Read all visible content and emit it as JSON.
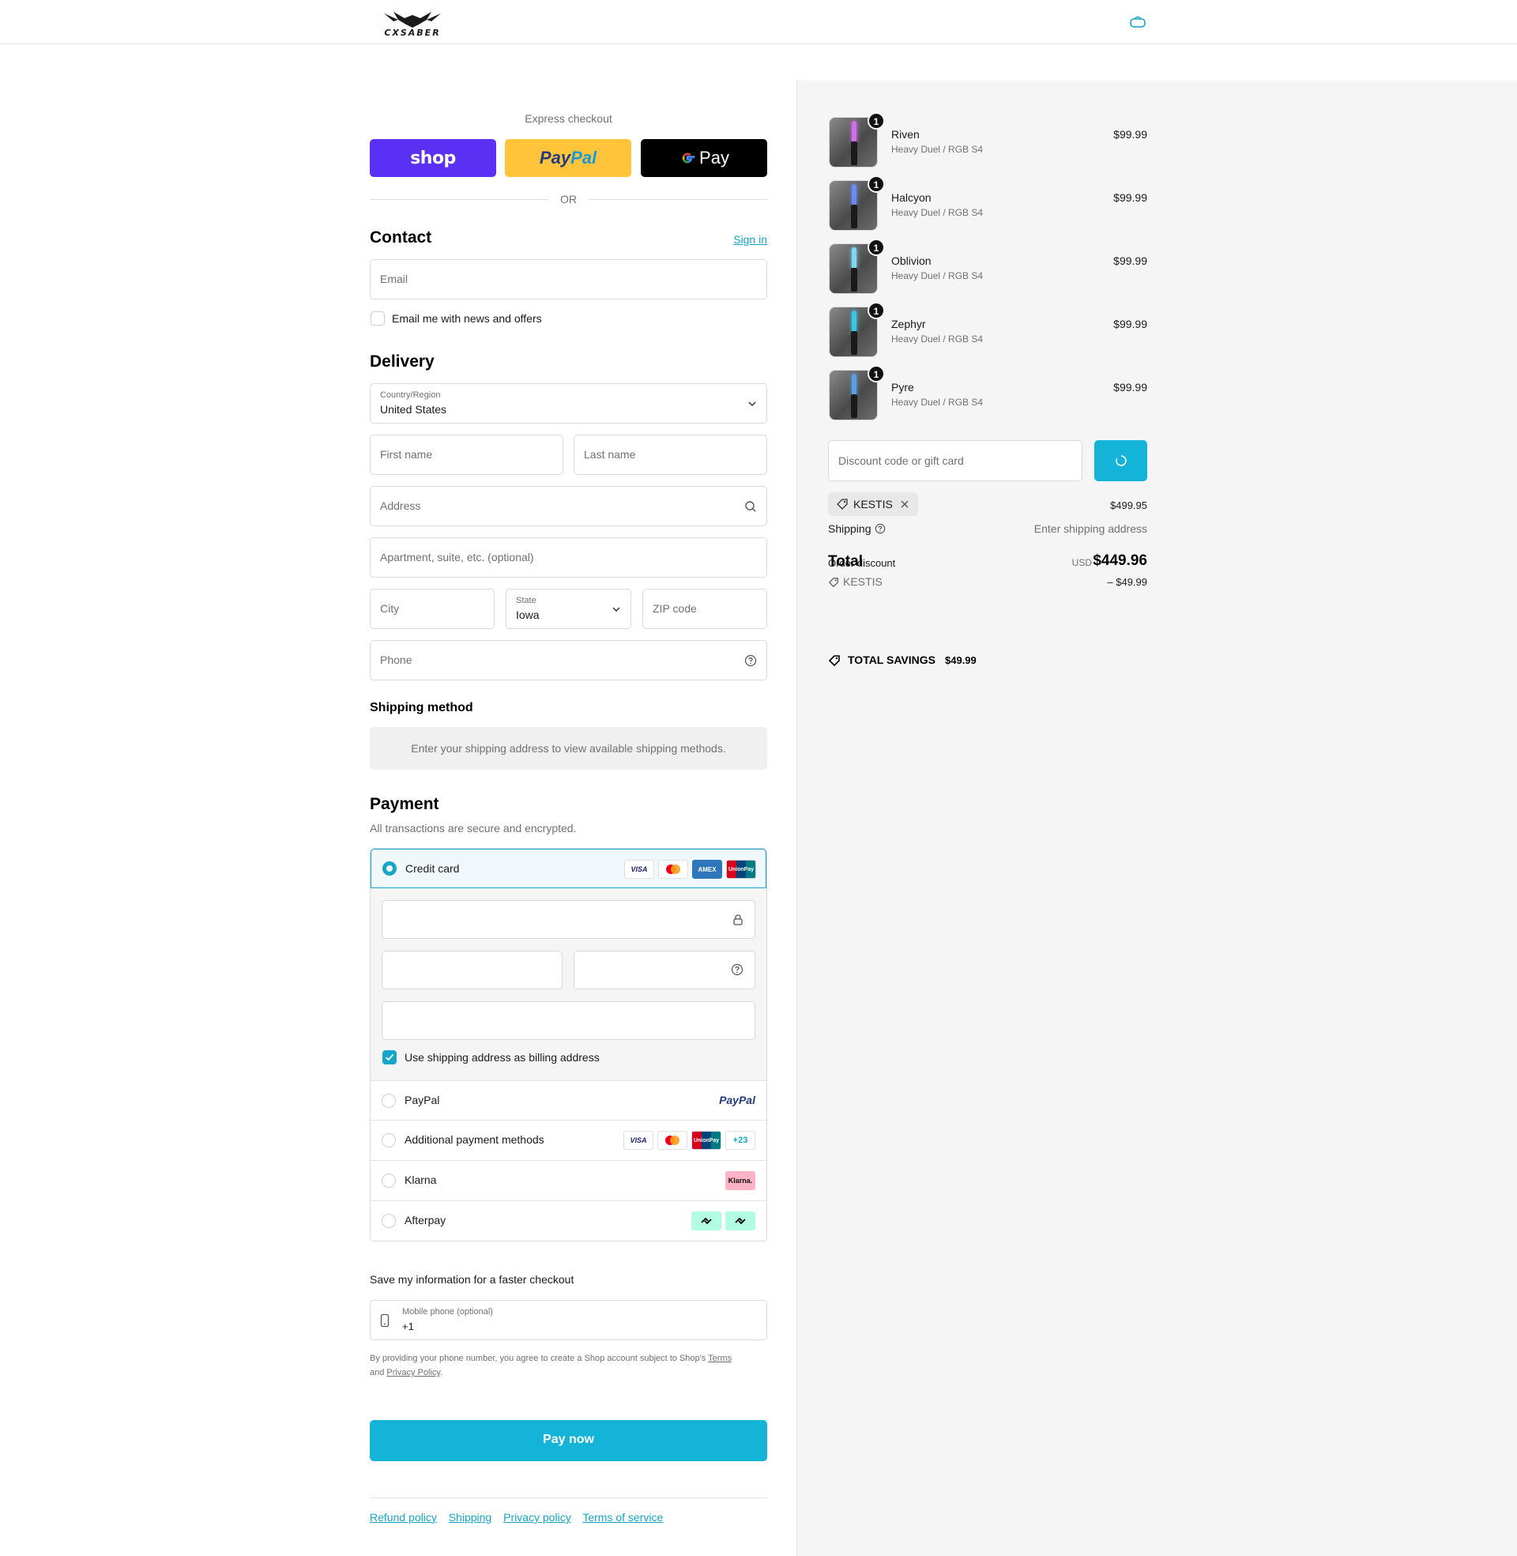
{
  "header": {
    "logo_text": "CXSABER",
    "bag_icon": "bag-icon"
  },
  "express": {
    "title": "Express checkout",
    "shop_label": "shop",
    "paypal_label_1": "Pay",
    "paypal_label_2": "Pal",
    "gpay_label": "Pay",
    "or_label": "OR"
  },
  "contact": {
    "title": "Contact",
    "sign_in": "Sign in",
    "email_placeholder": "Email",
    "newsletter_label": "Email me with news and offers"
  },
  "delivery": {
    "title": "Delivery",
    "country_label": "Country/Region",
    "country_value": "United States",
    "first_name_placeholder": "First name",
    "last_name_placeholder": "Last name",
    "address_placeholder": "Address",
    "apartment_placeholder": "Apartment, suite, etc. (optional)",
    "city_placeholder": "City",
    "state_label": "State",
    "state_value": "Iowa",
    "zip_placeholder": "ZIP code",
    "phone_placeholder": "Phone"
  },
  "shipping_method": {
    "title": "Shipping method",
    "message": "Enter your shipping address to view available shipping methods."
  },
  "payment": {
    "title": "Payment",
    "subtitle": "All transactions are secure and encrypted.",
    "credit_card_label": "Credit card",
    "card_brands": [
      "VISA",
      "AMEX",
      "UnionPay"
    ],
    "billing_same_label": "Use shipping address as billing address",
    "paypal_label": "PayPal",
    "paypal_logo": "PayPal",
    "additional_label": "Additional payment methods",
    "additional_more": "+23",
    "klarna_label": "Klarna",
    "klarna_badge": "Klarna.",
    "afterpay_label": "Afterpay"
  },
  "save_info": {
    "title": "Save my information for a faster checkout",
    "mobile_label": "Mobile phone (optional)",
    "mobile_value": "+1",
    "disclaimer_1": "By providing your phone number, you agree to create a Shop account subject to Shop's",
    "terms": "Terms",
    "disclaimer_and": "and",
    "privacy": "Privacy Policy",
    "disclaimer_end": "."
  },
  "pay_now": "Pay now",
  "footer": {
    "links": [
      "Refund policy",
      "Shipping",
      "Privacy policy",
      "Terms of service"
    ]
  },
  "cart": {
    "items": [
      {
        "name": "Riven",
        "variant": "Heavy Duel / RGB S4",
        "price": "$99.99",
        "qty": "1",
        "blade_color": "#d070e8"
      },
      {
        "name": "Halcyon",
        "variant": "Heavy Duel / RGB S4",
        "price": "$99.99",
        "qty": "1",
        "blade_color": "#6a8cf0"
      },
      {
        "name": "Oblivion",
        "variant": "Heavy Duel / RGB S4",
        "price": "$99.99",
        "qty": "1",
        "blade_color": "#7fd8f0"
      },
      {
        "name": "Zephyr",
        "variant": "Heavy Duel / RGB S4",
        "price": "$99.99",
        "qty": "1",
        "blade_color": "#3cc6e6"
      },
      {
        "name": "Pyre",
        "variant": "Heavy Duel / RGB S4",
        "price": "$99.99",
        "qty": "1",
        "blade_color": "#5aa0e0"
      }
    ],
    "discount_placeholder": "Discount code or gift card",
    "applied_code": "KESTIS",
    "subtotal": "$499.95",
    "shipping_label": "Shipping",
    "shipping_value": "Enter shipping address",
    "total_label": "Total",
    "order_discount_label": "Order discount",
    "currency": "USD",
    "total_value": "$449.96",
    "discount_code": "KESTIS",
    "discount_value": "– $49.99",
    "savings_label": "TOTAL SAVINGS",
    "savings_value": "$49.99"
  },
  "colors": {
    "accent": "#14b4d8",
    "link": "#14a5c8",
    "shop_purple": "#5a31f4",
    "paypal_yellow": "#ffc439"
  }
}
